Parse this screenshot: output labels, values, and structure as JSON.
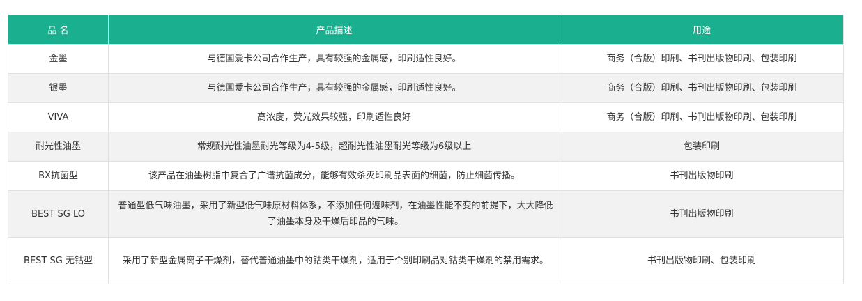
{
  "table": {
    "headers": [
      "品 名",
      "产品描述",
      "用途"
    ],
    "rows": [
      {
        "name": "金墨",
        "description": "与德国爱卡公司合作生产，具有较强的金属感，印刷适性良好。",
        "usage": "商务（合版）印刷、书刊出版物印刷、包装印刷"
      },
      {
        "name": "银墨",
        "description": "与德国爱卡公司合作生产，具有较强的金属感，印刷适性良好。",
        "usage": "商务（合版）印刷、书刊出版物印刷、包装印刷"
      },
      {
        "name": "VIVA",
        "description": "高浓度，荧光效果较强，印刷适性良好",
        "usage": "商务（合版）印刷、书刊出版物印刷、包装印刷"
      },
      {
        "name": "耐光性油墨",
        "description": "常规耐光性油墨耐光等级为4-5级，超耐光性油墨耐光等级为6级以上",
        "usage": "包装印刷"
      },
      {
        "name": "BX抗菌型",
        "description": "该产品在油墨树脂中复合了广谱抗菌成分，能够有效杀灭印刷品表面的细菌，防止细菌传播。",
        "usage": "书刊出版物印刷"
      },
      {
        "name": "BEST SG LO",
        "description": "普通型低气味油墨，采用了新型低气味原材料体系，不添加任何遮味剂，在油墨性能不变的前提下，大大降低了油墨本身及干燥后印品的气味。",
        "usage": "书刊出版物印刷"
      },
      {
        "name": "BEST SG 无钴型",
        "description": "采用了新型金属离子干燥剂，替代普通油墨中的钴类干燥剂，适用于个别印刷品对钴类干燥剂的禁用需求。",
        "usage": "书刊出版物印刷、包装印刷"
      }
    ]
  },
  "colors": {
    "header_bg": "#1aaf8e",
    "header_text": "#ffffff",
    "row_alt_bg": "#f2f2f2",
    "border": "#e0e0e0",
    "text": "#333333"
  }
}
